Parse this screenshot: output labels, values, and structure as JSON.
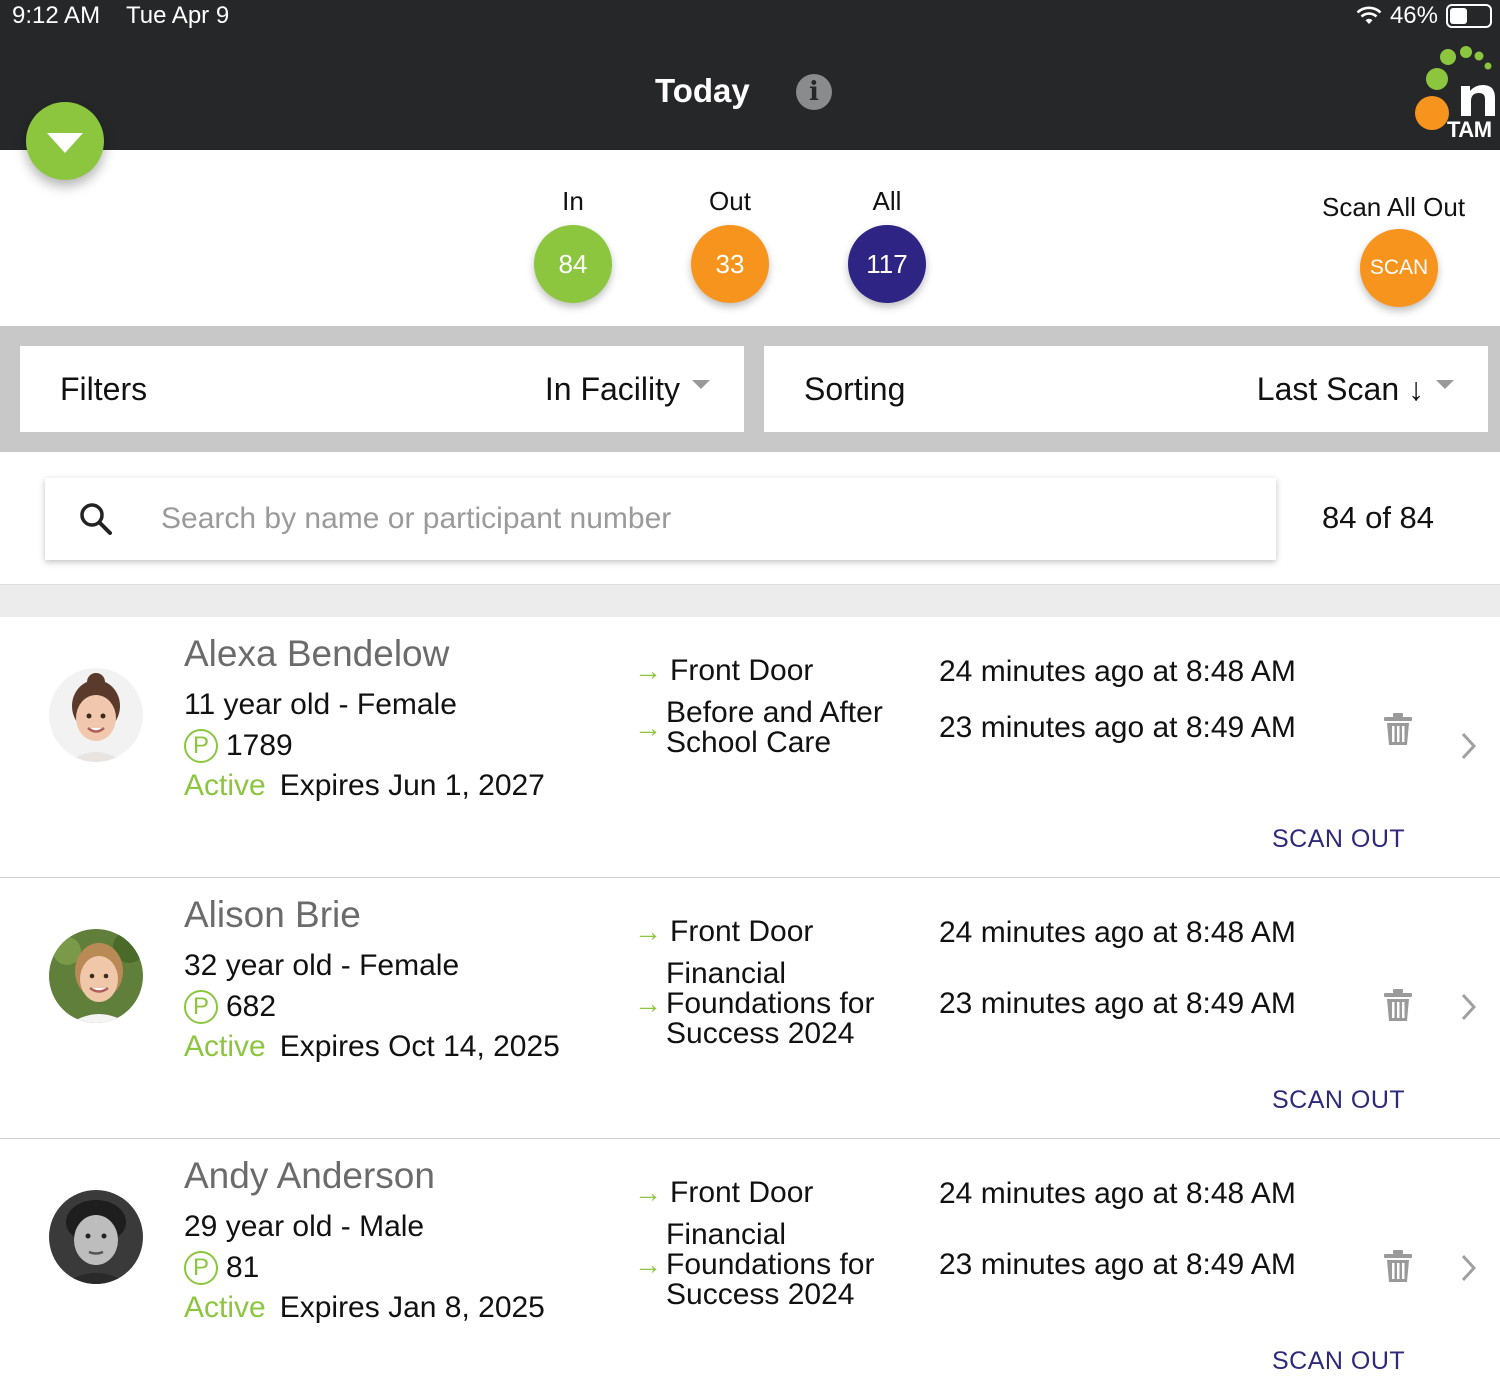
{
  "status_bar": {
    "time": "9:12 AM",
    "date": "Tue Apr 9",
    "battery": "46%",
    "battery_level": 0.46
  },
  "header": {
    "title": "Today",
    "logo_text": "TAM"
  },
  "colors": {
    "green": "#8cc63f",
    "orange": "#f7941d",
    "purple": "#2e2484",
    "header_bg": "#262729"
  },
  "counters": [
    {
      "label": "In",
      "value": "84",
      "color": "#8cc63f"
    },
    {
      "label": "Out",
      "value": "33",
      "color": "#f7941d"
    },
    {
      "label": "All",
      "value": "117",
      "color": "#2e2484"
    }
  ],
  "scan_all": {
    "label": "Scan All Out",
    "button": "SCAN"
  },
  "filters": {
    "label": "Filters",
    "value": "In Facility"
  },
  "sorting": {
    "label": "Sorting",
    "value": "Last Scan ↓"
  },
  "search": {
    "placeholder": "Search by name or participant number",
    "count": "84 of 84"
  },
  "rows": [
    {
      "name": "Alexa Bendelow",
      "details": "11 year old - Female",
      "participant_badge": "P",
      "participant_number": "1789",
      "status": "Active",
      "expires": "Expires Jun 1, 2027",
      "locations": [
        {
          "arrow": "→",
          "text": "Front Door",
          "time": "24 minutes ago at 8:48 AM"
        },
        {
          "arrow": "→",
          "text": "Before and After School Care",
          "time": "23 minutes ago at 8:49 AM"
        }
      ],
      "action": "SCAN OUT"
    },
    {
      "name": "Alison Brie",
      "details": "32 year old - Female",
      "participant_badge": "P",
      "participant_number": "682",
      "status": "Active",
      "expires": "Expires Oct 14, 2025",
      "locations": [
        {
          "arrow": "→",
          "text": "Front Door",
          "time": "24 minutes ago at 8:48 AM"
        },
        {
          "arrow": "→",
          "text": "Financial Foundations for Success 2024",
          "time": "23 minutes ago at 8:49 AM"
        }
      ],
      "action": "SCAN OUT"
    },
    {
      "name": "Andy Anderson",
      "details": "29 year old - Male",
      "participant_badge": "P",
      "participant_number": "81",
      "status": "Active",
      "expires": "Expires Jan 8, 2025",
      "locations": [
        {
          "arrow": "→",
          "text": "Front Door",
          "time": "24 minutes ago at 8:48 AM"
        },
        {
          "arrow": "→",
          "text": "Financial Foundations for Success 2024",
          "time": "23 minutes ago at 8:49 AM"
        }
      ],
      "action": "SCAN OUT"
    }
  ]
}
